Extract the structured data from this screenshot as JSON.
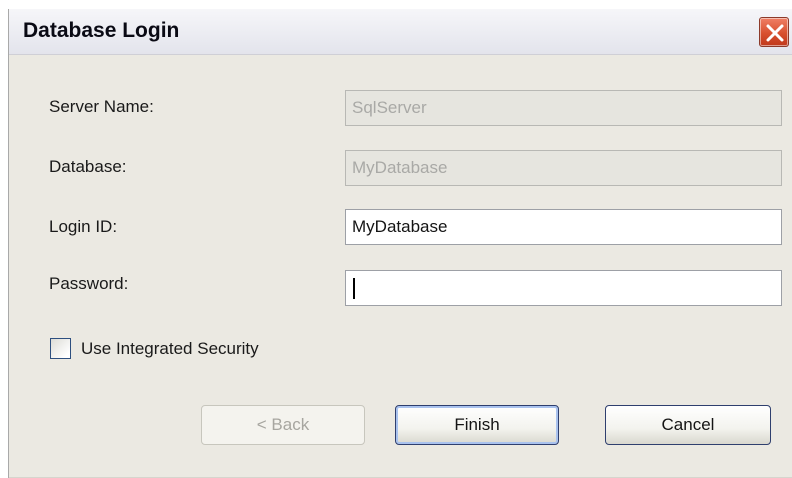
{
  "window": {
    "title": "Database Login"
  },
  "form": {
    "server_name": {
      "label": "Server Name:",
      "value": "SqlServer",
      "enabled": false
    },
    "database": {
      "label": "Database:",
      "value": "MyDatabase",
      "enabled": false
    },
    "login_id": {
      "label": "Login ID:",
      "value": "MyDatabase",
      "enabled": true
    },
    "password": {
      "label": "Password:",
      "value": "",
      "enabled": true
    }
  },
  "options": {
    "integrated_security": {
      "label": "Use Integrated Security",
      "checked": false
    }
  },
  "buttons": {
    "back": "< Back",
    "finish": "Finish",
    "cancel": "Cancel"
  },
  "icons": {
    "close": "close-icon"
  },
  "colors": {
    "dialog_background": "#ebe9e2",
    "close_button": "#d8502f",
    "disabled_text": "#a9a9a6"
  }
}
